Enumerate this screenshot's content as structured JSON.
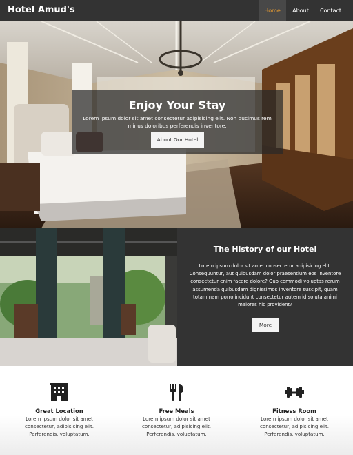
{
  "navbar": {
    "brand": "Hotel Amud's",
    "items": [
      {
        "label": "Home",
        "active": true
      },
      {
        "label": "About",
        "active": false
      },
      {
        "label": "Contact",
        "active": false
      }
    ],
    "active_color": "#f0a030"
  },
  "showcase": {
    "title": "Enjoy Your Stay",
    "text": "Lorem ipsum dolor sit amet consectetur adipisicing elit. Non ducimus rem minus doloribus perferendis inventore.",
    "button_label": "About Our Hotel"
  },
  "history": {
    "title": "The History of our Hotel",
    "text": "Lorem ipsum dolor sit amet consectetur adipisicing elit. Consequuntur, aut quibusdam dolor praesentium eos inventore consectetur enim facere dolore? Quo commodi voluptas rerum assumenda quibusdam dignissimos inventore suscipit, quam totam nam porro incidunt consectetur autem id soluta animi maiores hic provident?",
    "button_label": "More"
  },
  "features": [
    {
      "icon": "building-icon",
      "title": "Great Location",
      "text": "Lorem ipsum dolor sit amet consectetur, adipisicing elit. Perferendis, voluptatum."
    },
    {
      "icon": "utensils-icon",
      "title": "Free Meals",
      "text": "Lorem ipsum dolor sit amet consectetur, adipisicing elit. Perferendis, voluptatum."
    },
    {
      "icon": "dumbbell-icon",
      "title": "Fitness Room",
      "text": "Lorem ipsum dolor sit amet consectetur, adipisicing elit. Perferendis, voluptatum."
    }
  ],
  "colors": {
    "dark": "#333333",
    "light_button": "#f4f4f4"
  }
}
